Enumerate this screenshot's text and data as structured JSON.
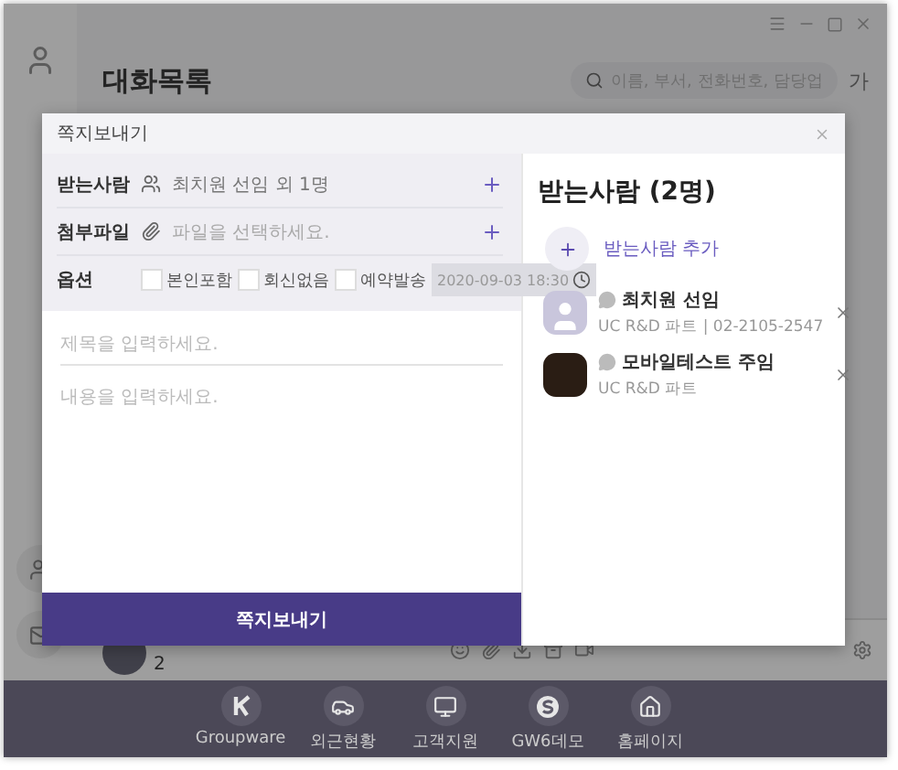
{
  "app": {
    "title": "대화목록",
    "search": {
      "placeholder": "이름, 부서, 전화번호, 담당업"
    },
    "font_button": "가",
    "chat_count": "2"
  },
  "dialog": {
    "title": "쪽지보내기",
    "fields": [
      {
        "label": "받는사람",
        "kind": "people",
        "value": "최치원 선임 외 1명"
      },
      {
        "label": "첨부파일",
        "kind": "attach",
        "placeholder": "파일을 선택하세요."
      }
    ],
    "options": {
      "label": "옵션",
      "items": [
        {
          "label": "본인포함",
          "checked": false
        },
        {
          "label": "회신없음",
          "checked": false
        },
        {
          "label": "예약발송",
          "checked": false
        }
      ],
      "schedule_time": "2020-09-03 18:30"
    },
    "subject": {
      "placeholder": "제목을 입력하세요."
    },
    "body": {
      "placeholder": "내용을 입력하세요."
    },
    "send_button": "쪽지보내기"
  },
  "recipients": {
    "title": "받는사람 (2명)",
    "add_label": "받는사람 추가",
    "items": [
      {
        "name": "최치원 선임",
        "detail": "UC R&D 파트 | 02-2105-2547",
        "kind": "default"
      },
      {
        "name": "모바일테스트 주임",
        "detail": "UC R&D 파트",
        "kind": "photo"
      }
    ]
  },
  "dock": [
    {
      "label": "Groupware",
      "kind": "k"
    },
    {
      "label": "외근현황",
      "kind": "car"
    },
    {
      "label": "고객지원",
      "kind": "monitor"
    },
    {
      "label": "GW6데모",
      "kind": "s"
    },
    {
      "label": "홈페이지",
      "kind": "home"
    }
  ]
}
